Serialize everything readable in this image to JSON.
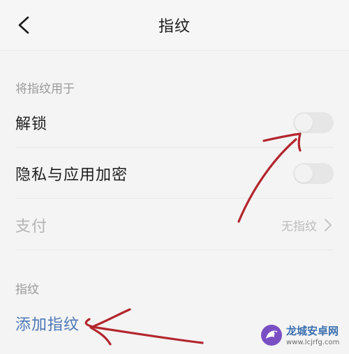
{
  "header": {
    "title": "指纹",
    "back_icon": "chevron-left-icon"
  },
  "use_section": {
    "label": "将指纹用于",
    "items": [
      {
        "label": "解锁",
        "toggle": "off"
      },
      {
        "label": "隐私与应用加密",
        "toggle": "off"
      },
      {
        "label": "支付",
        "value": "无指纹",
        "disabled": true,
        "icon": "chevron-right-icon"
      }
    ]
  },
  "fingerprint_section": {
    "label": "指纹",
    "add_label": "添加指纹"
  },
  "watermark": {
    "title": "龙城安卓网",
    "url": "www.lcjrfg.com"
  },
  "colors": {
    "link": "#4c78b8",
    "annotation": "#b3262e",
    "background": "#f4f4f4"
  }
}
